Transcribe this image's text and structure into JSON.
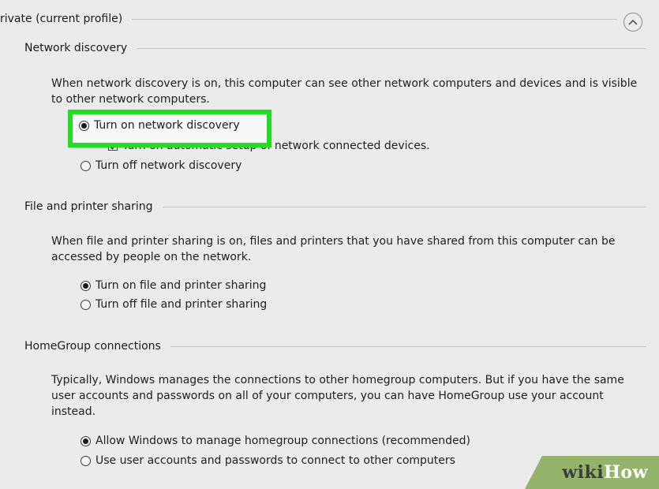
{
  "profile": {
    "title": "rivate (current profile)"
  },
  "network_discovery": {
    "heading": "Network discovery",
    "description": "When network discovery is on, this computer can see other network computers and devices and is visible to other network computers.",
    "option_on": "Turn on network discovery",
    "auto_setup": "Turn on automatic setup of network connected devices.",
    "option_off": "Turn off network discovery"
  },
  "file_sharing": {
    "heading": "File and printer sharing",
    "description": "When file and printer sharing is on, files and printers that you have shared from this computer can be accessed by people on the network.",
    "option_on": "Turn on file and printer sharing",
    "option_off": "Turn off file and printer sharing"
  },
  "homegroup": {
    "heading": "HomeGroup connections",
    "description": "Typically, Windows manages the connections to other homegroup computers. But if you have the same user accounts and passwords on all of your computers, you can have HomeGroup use your account instead.",
    "option_allow": "Allow Windows to manage homegroup connections (recommended)",
    "option_user": "Use user accounts and passwords to connect to other computers"
  },
  "watermark": {
    "wiki": "wiki",
    "how": "How"
  },
  "colors": {
    "highlight": "#22dd22",
    "watermark_bg": "#93b46a"
  }
}
